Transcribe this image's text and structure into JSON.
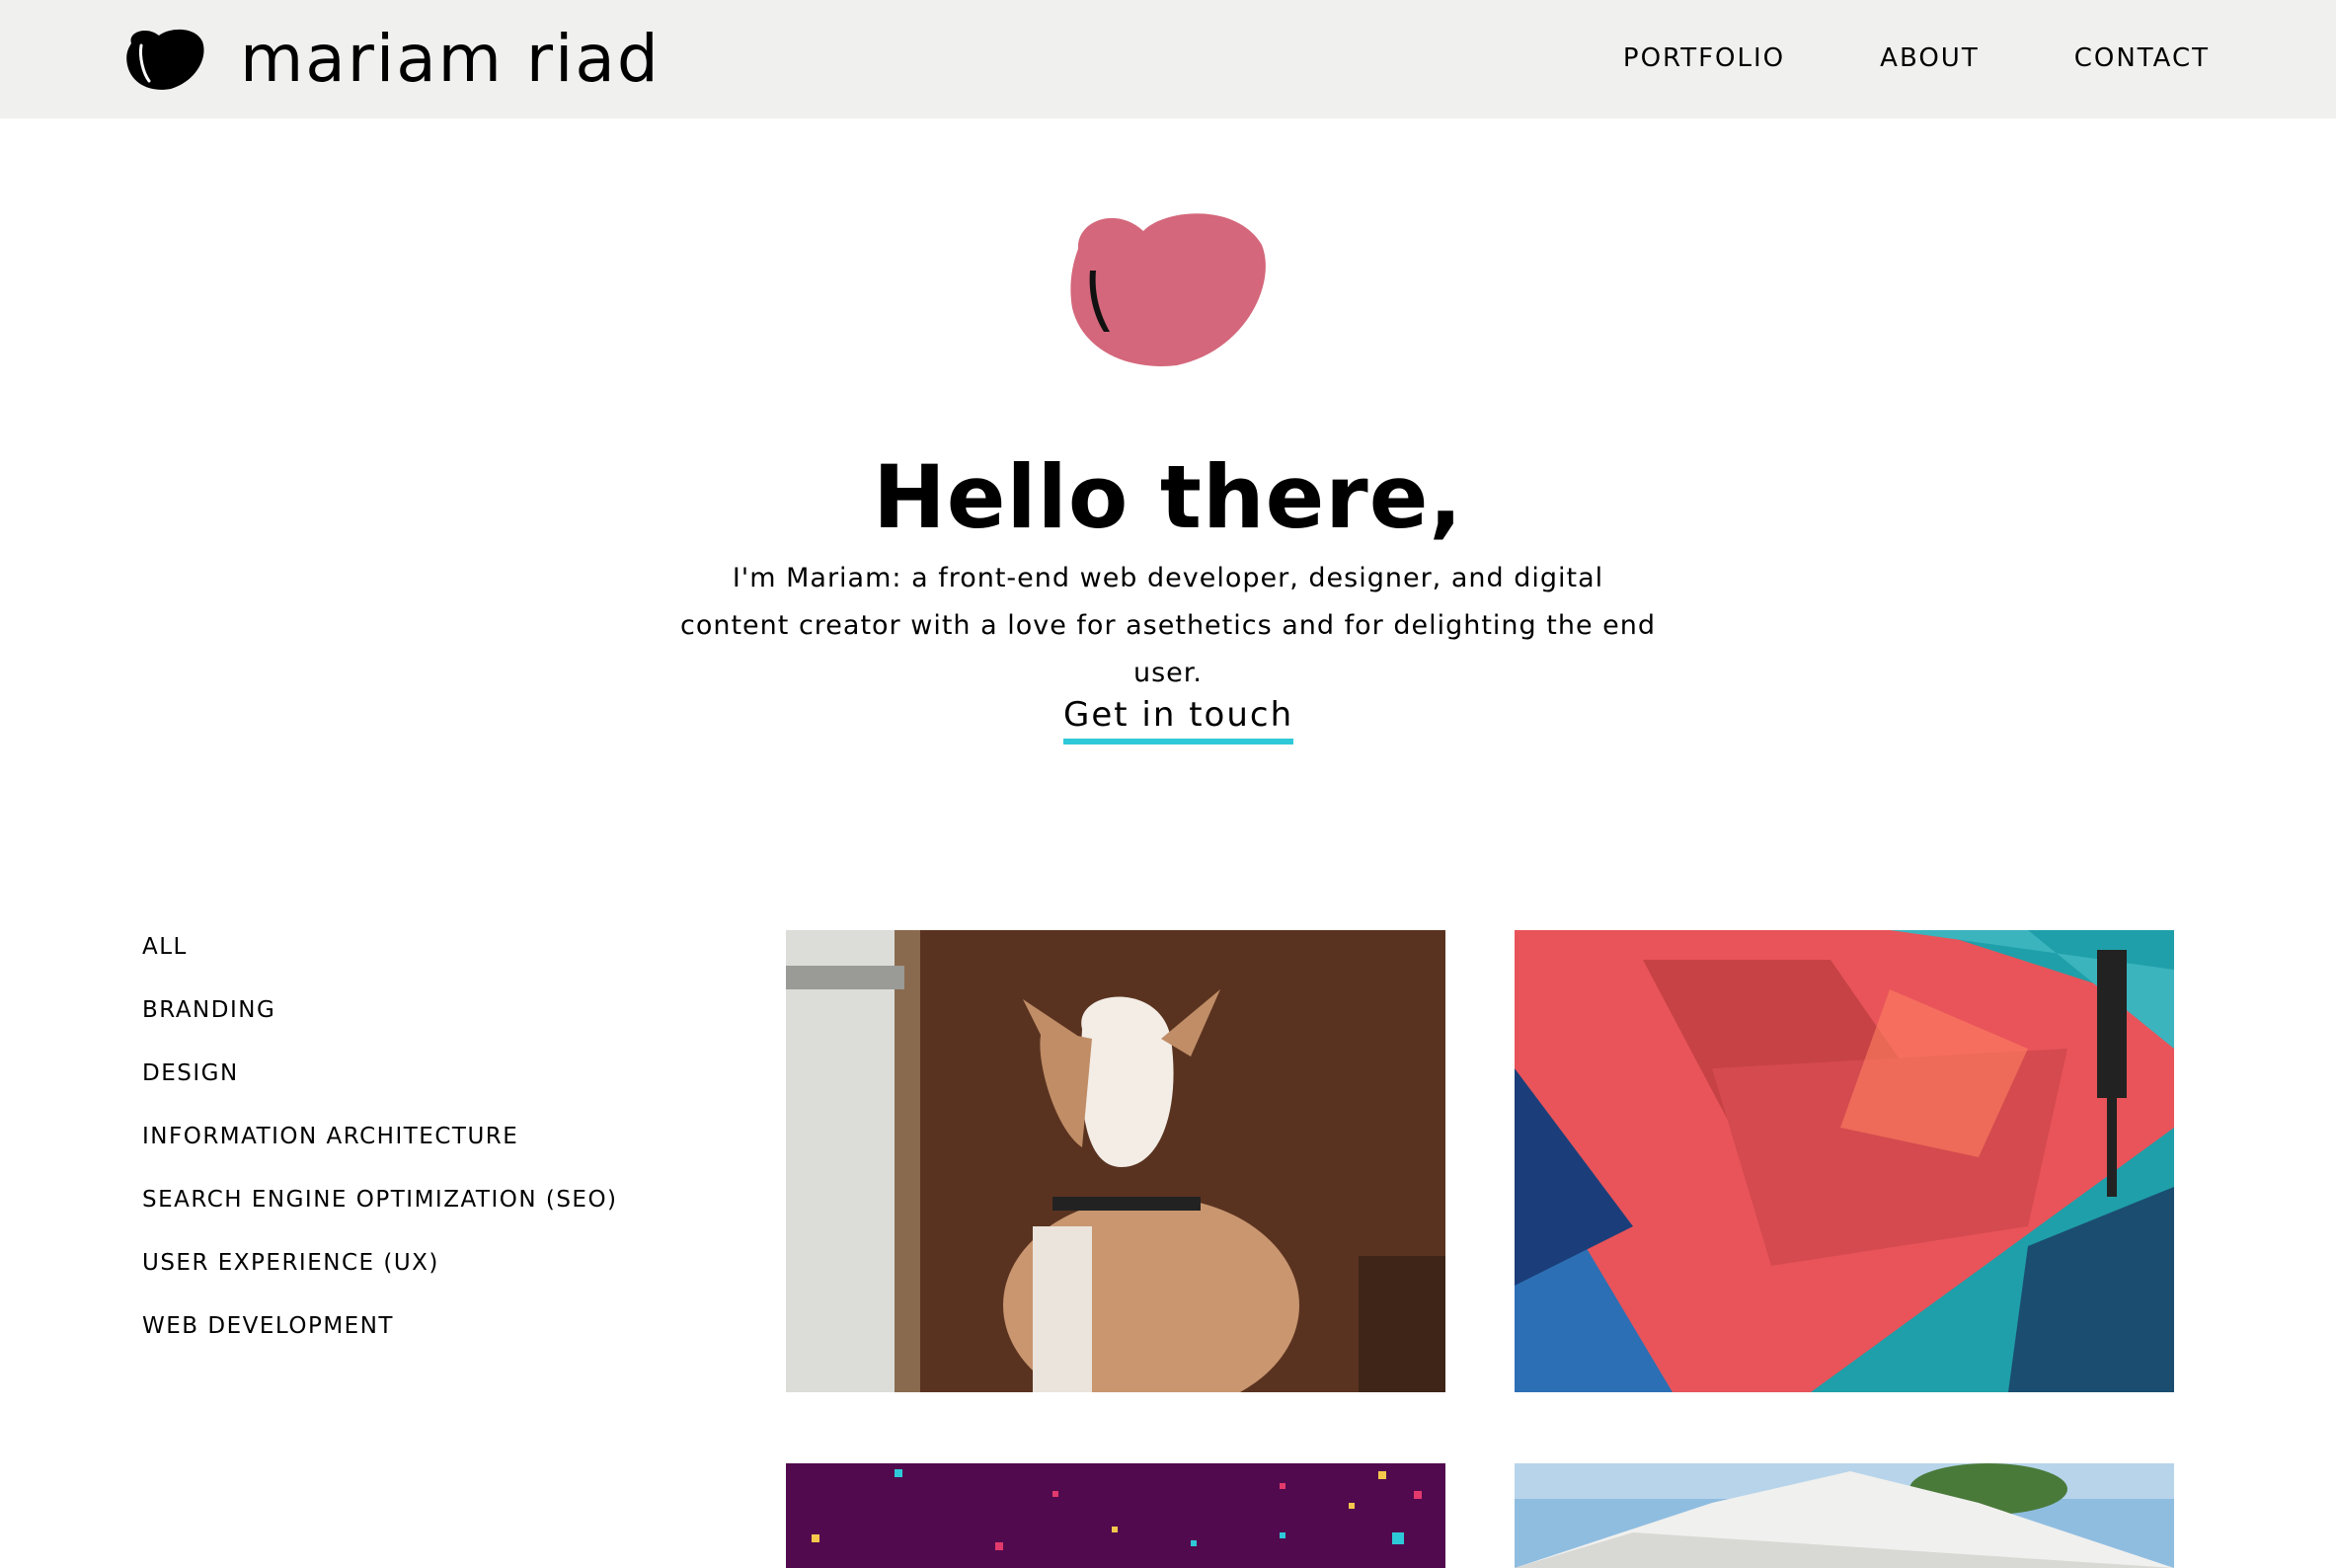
{
  "header": {
    "brand": "mariam riad",
    "nav": [
      {
        "label": "PORTFOLIO"
      },
      {
        "label": "ABOUT"
      },
      {
        "label": "CONTACT"
      }
    ]
  },
  "hero": {
    "title": "Hello there,",
    "text": "I'm Mariam: a front-end web developer, designer, and digital content creator with a love for asethetics and for delighting the end user.",
    "cta": "Get in touch",
    "accent_color": "#2ec9d8",
    "heart_color": "#d4677b"
  },
  "filters": [
    "ALL",
    "BRANDING",
    "DESIGN",
    "INFORMATION ARCHITECTURE",
    "SEARCH ENGINE OPTIMIZATION (SEO)",
    "USER EXPERIENCE (UX)",
    "WEB DEVELOPMENT"
  ],
  "portfolio": {
    "tiles": [
      {
        "image": "goat-photo"
      },
      {
        "image": "street-mural-photo"
      },
      {
        "image": "purple-confetti-graphic"
      },
      {
        "image": "white-tent-photo"
      }
    ]
  }
}
